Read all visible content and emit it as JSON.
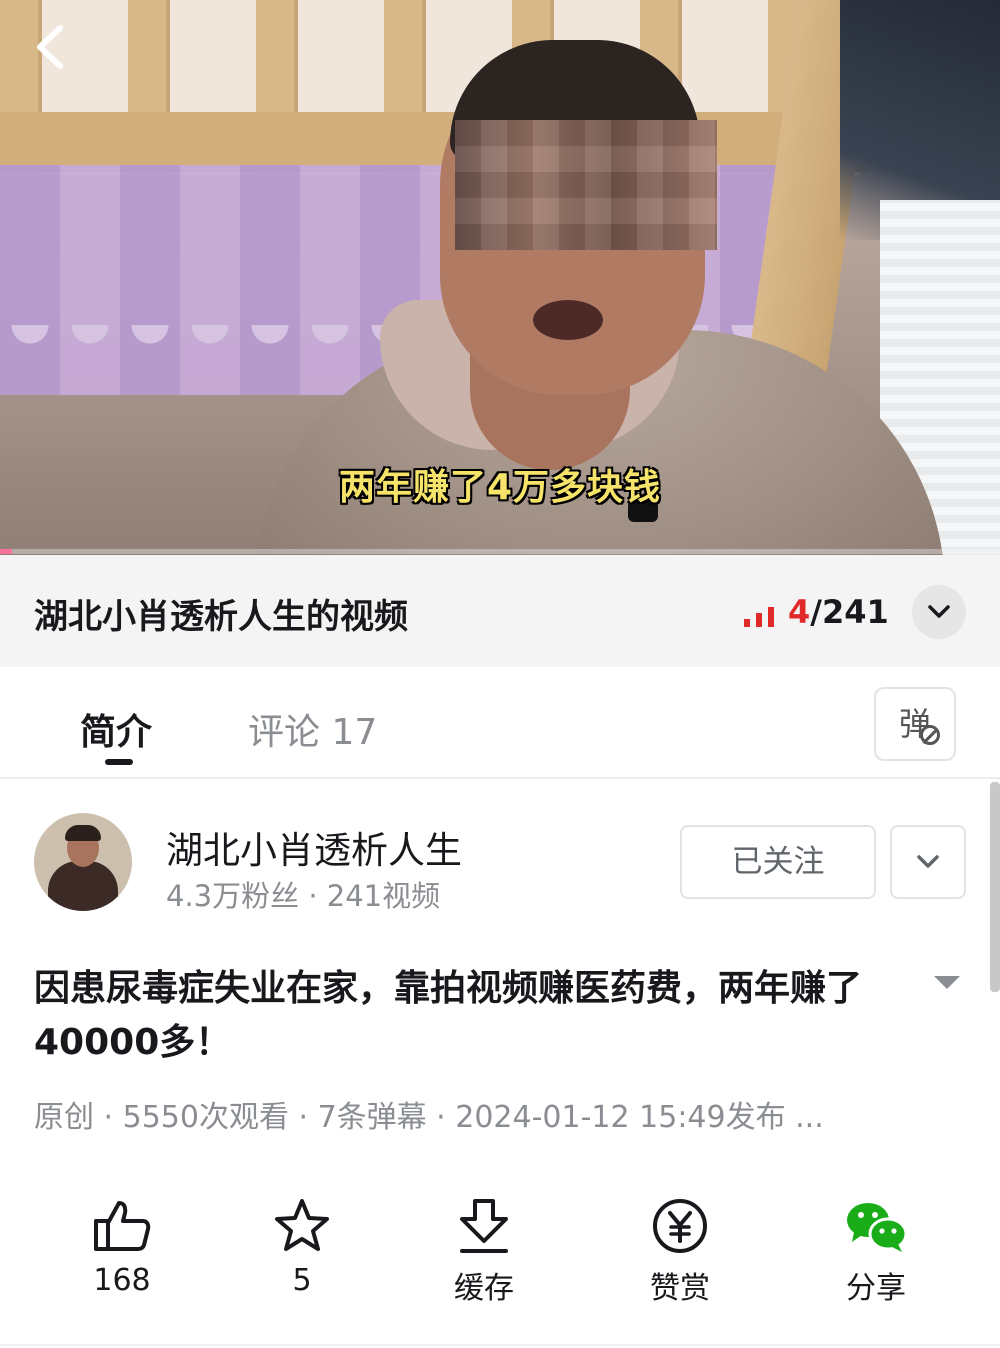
{
  "video": {
    "subtitle": "两年赚了4万多块钱",
    "progress_fraction": 0.012,
    "back_icon": "back-chevron-icon"
  },
  "collection": {
    "title": "湖北小肖透析人生的视频",
    "current": "4",
    "total": "/241",
    "accent_color": "#e02a2a"
  },
  "tabs": {
    "intro": "简介",
    "comments": "评论 17",
    "danmaku": "弹"
  },
  "uploader": {
    "name": "湖北小肖透析人生",
    "stats": "4.3万粉丝 · 241视频",
    "follow_label": "已关注"
  },
  "video_info": {
    "title": "因患尿毒症失业在家，靠拍视频赚医药费，两年赚了40000多！",
    "meta": "原创 · 5550次观看 · 7条弹幕 · 2024-01-12 15:49发布 ..."
  },
  "actions": {
    "like": "168",
    "favorite": "5",
    "cache": "缓存",
    "tip": "赞赏",
    "share": "分享",
    "share_color": "#1aad19"
  }
}
